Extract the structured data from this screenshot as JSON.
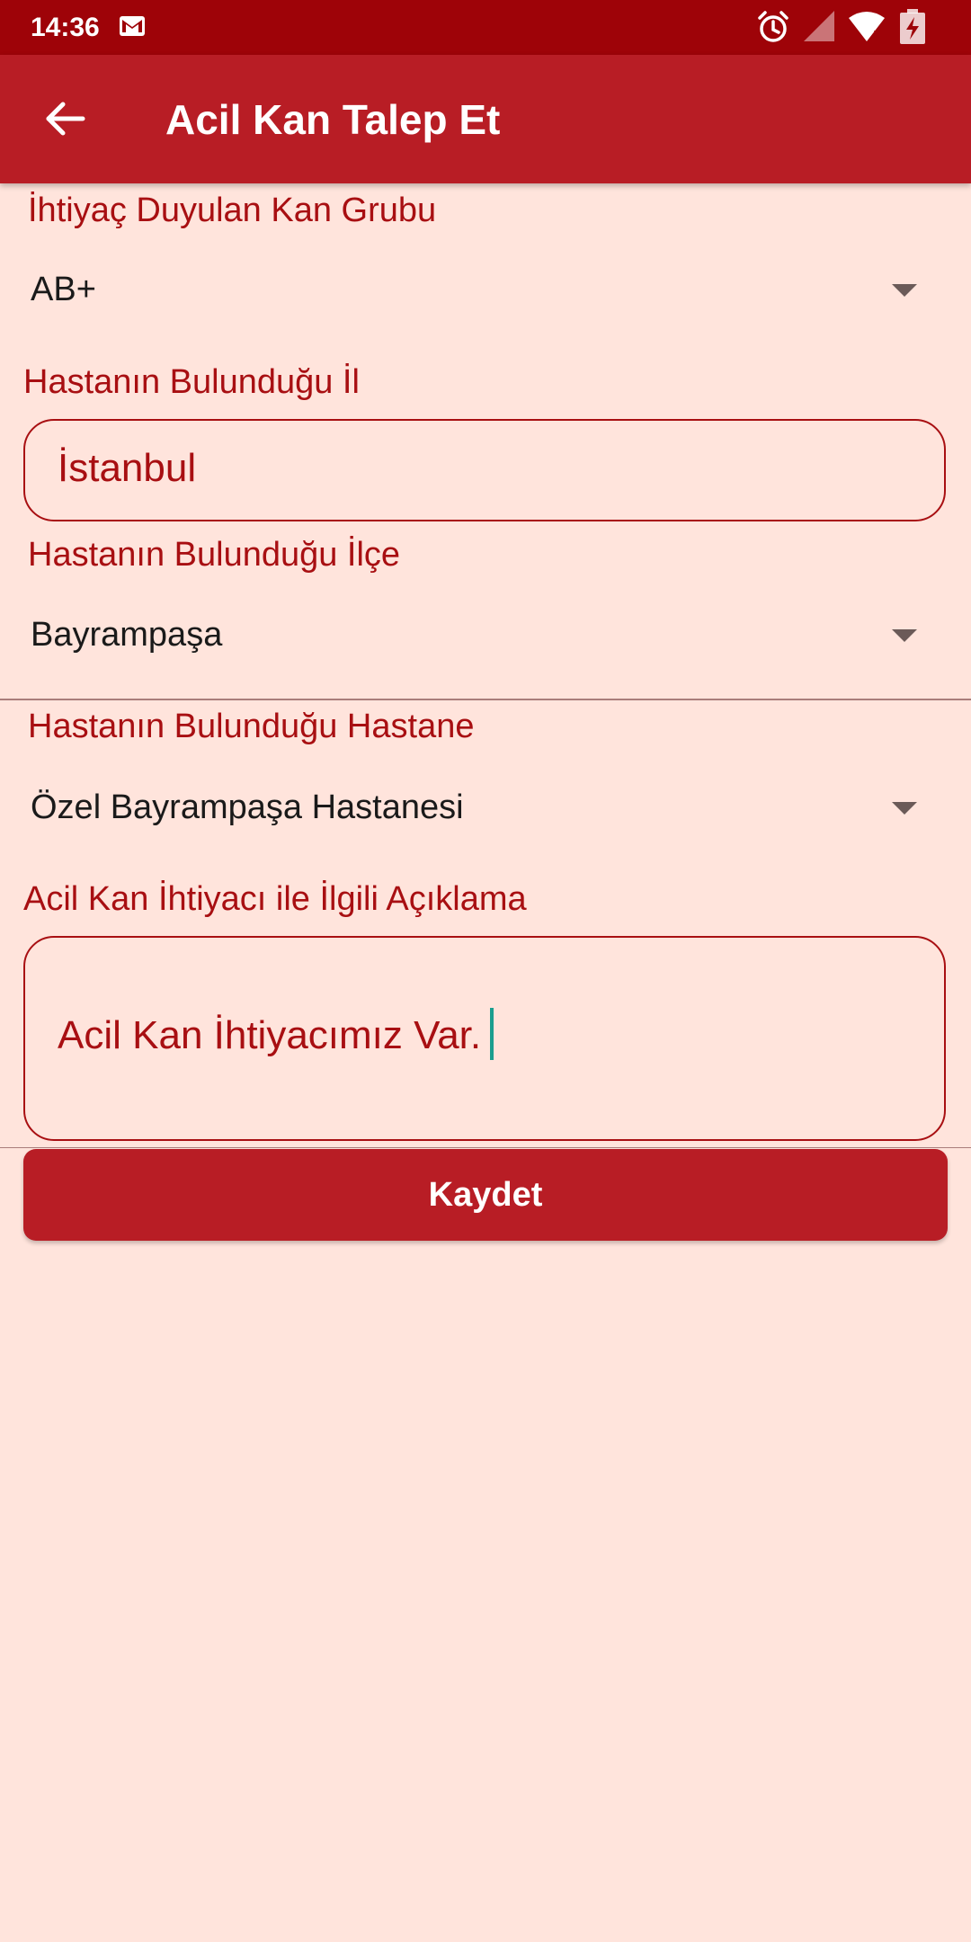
{
  "status_bar": {
    "time": "14:36",
    "icons": [
      "gmail-icon",
      "alarm-icon",
      "signal-icon",
      "wifi-icon",
      "battery-charging-icon"
    ]
  },
  "app_bar": {
    "back_icon": "arrow-back-icon",
    "title": "Acil Kan Talep Et"
  },
  "form": {
    "blood_group": {
      "label": "İhtiyaç Duyulan Kan Grubu",
      "value": "AB+"
    },
    "city": {
      "label": "Hastanın Bulunduğu İl",
      "value": "İstanbul"
    },
    "district": {
      "label": "Hastanın Bulunduğu İlçe",
      "value": "Bayrampaşa"
    },
    "hospital": {
      "label": "Hastanın Bulunduğu Hastane",
      "value": "Özel Bayrampaşa Hastanesi"
    },
    "description": {
      "label": "Acil Kan İhtiyacı ile İlgili Açıklama",
      "value": "Acil Kan İhtiyacımız Var."
    },
    "save_label": "Kaydet"
  },
  "colors": {
    "status_bar": "#9e0308",
    "app_bar": "#b81d25",
    "background": "#ffe4dc",
    "label": "#a80f12",
    "button": "#b81d25",
    "cursor": "#1a9e8f"
  }
}
